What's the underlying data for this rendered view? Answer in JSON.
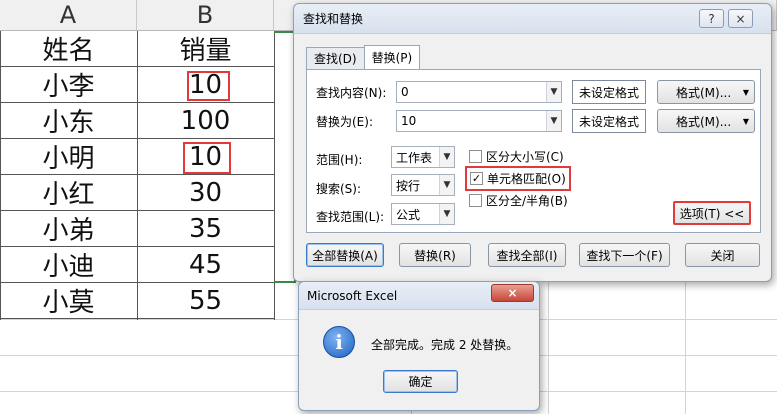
{
  "sheet": {
    "columns": [
      "A",
      "B"
    ],
    "header_row": {
      "a": "姓名",
      "b": "销量"
    },
    "rows": [
      {
        "name": "小李",
        "qty": "10"
      },
      {
        "name": "小东",
        "qty": "100"
      },
      {
        "name": "小明",
        "qty": "10"
      },
      {
        "name": "小红",
        "qty": "30"
      },
      {
        "name": "小弟",
        "qty": "35"
      },
      {
        "name": "小迪",
        "qty": "45"
      },
      {
        "name": "小莫",
        "qty": "55"
      }
    ],
    "highlight_color": "#e23a3a"
  },
  "find_replace": {
    "title": "查找和替换",
    "help": "?",
    "close": "×",
    "tabs": [
      "查找(D)",
      "替换(P)"
    ],
    "active_tab": "替换(P)",
    "find_label": "查找内容(N):",
    "find_value": "0",
    "replace_label": "替换为(E):",
    "replace_value": "10",
    "no_format": "未设定格式",
    "format_button": "格式(M)...",
    "within_label": "范围(H):",
    "within_value": "工作表",
    "search_label": "搜索(S):",
    "search_value": "按行",
    "look_in_label": "查找范围(L):",
    "look_in_value": "公式",
    "match_case": {
      "label": "区分大小写(C)",
      "checked": false
    },
    "match_cell": {
      "label": "单元格匹配(O)",
      "checked": true
    },
    "match_width": {
      "label": "区分全/半角(B)",
      "checked": false
    },
    "options_button": "选项(T) <<",
    "buttons": {
      "replace_all": "全部替换(A)",
      "replace": "替换(R)",
      "find_all": "查找全部(I)",
      "find_next": "查找下一个(F)",
      "close": "关闭"
    }
  },
  "message_box": {
    "title": "Microsoft Excel",
    "close": "×",
    "message": "全部完成。完成 2 处替换。",
    "icon": "info-icon",
    "ok": "确定"
  }
}
